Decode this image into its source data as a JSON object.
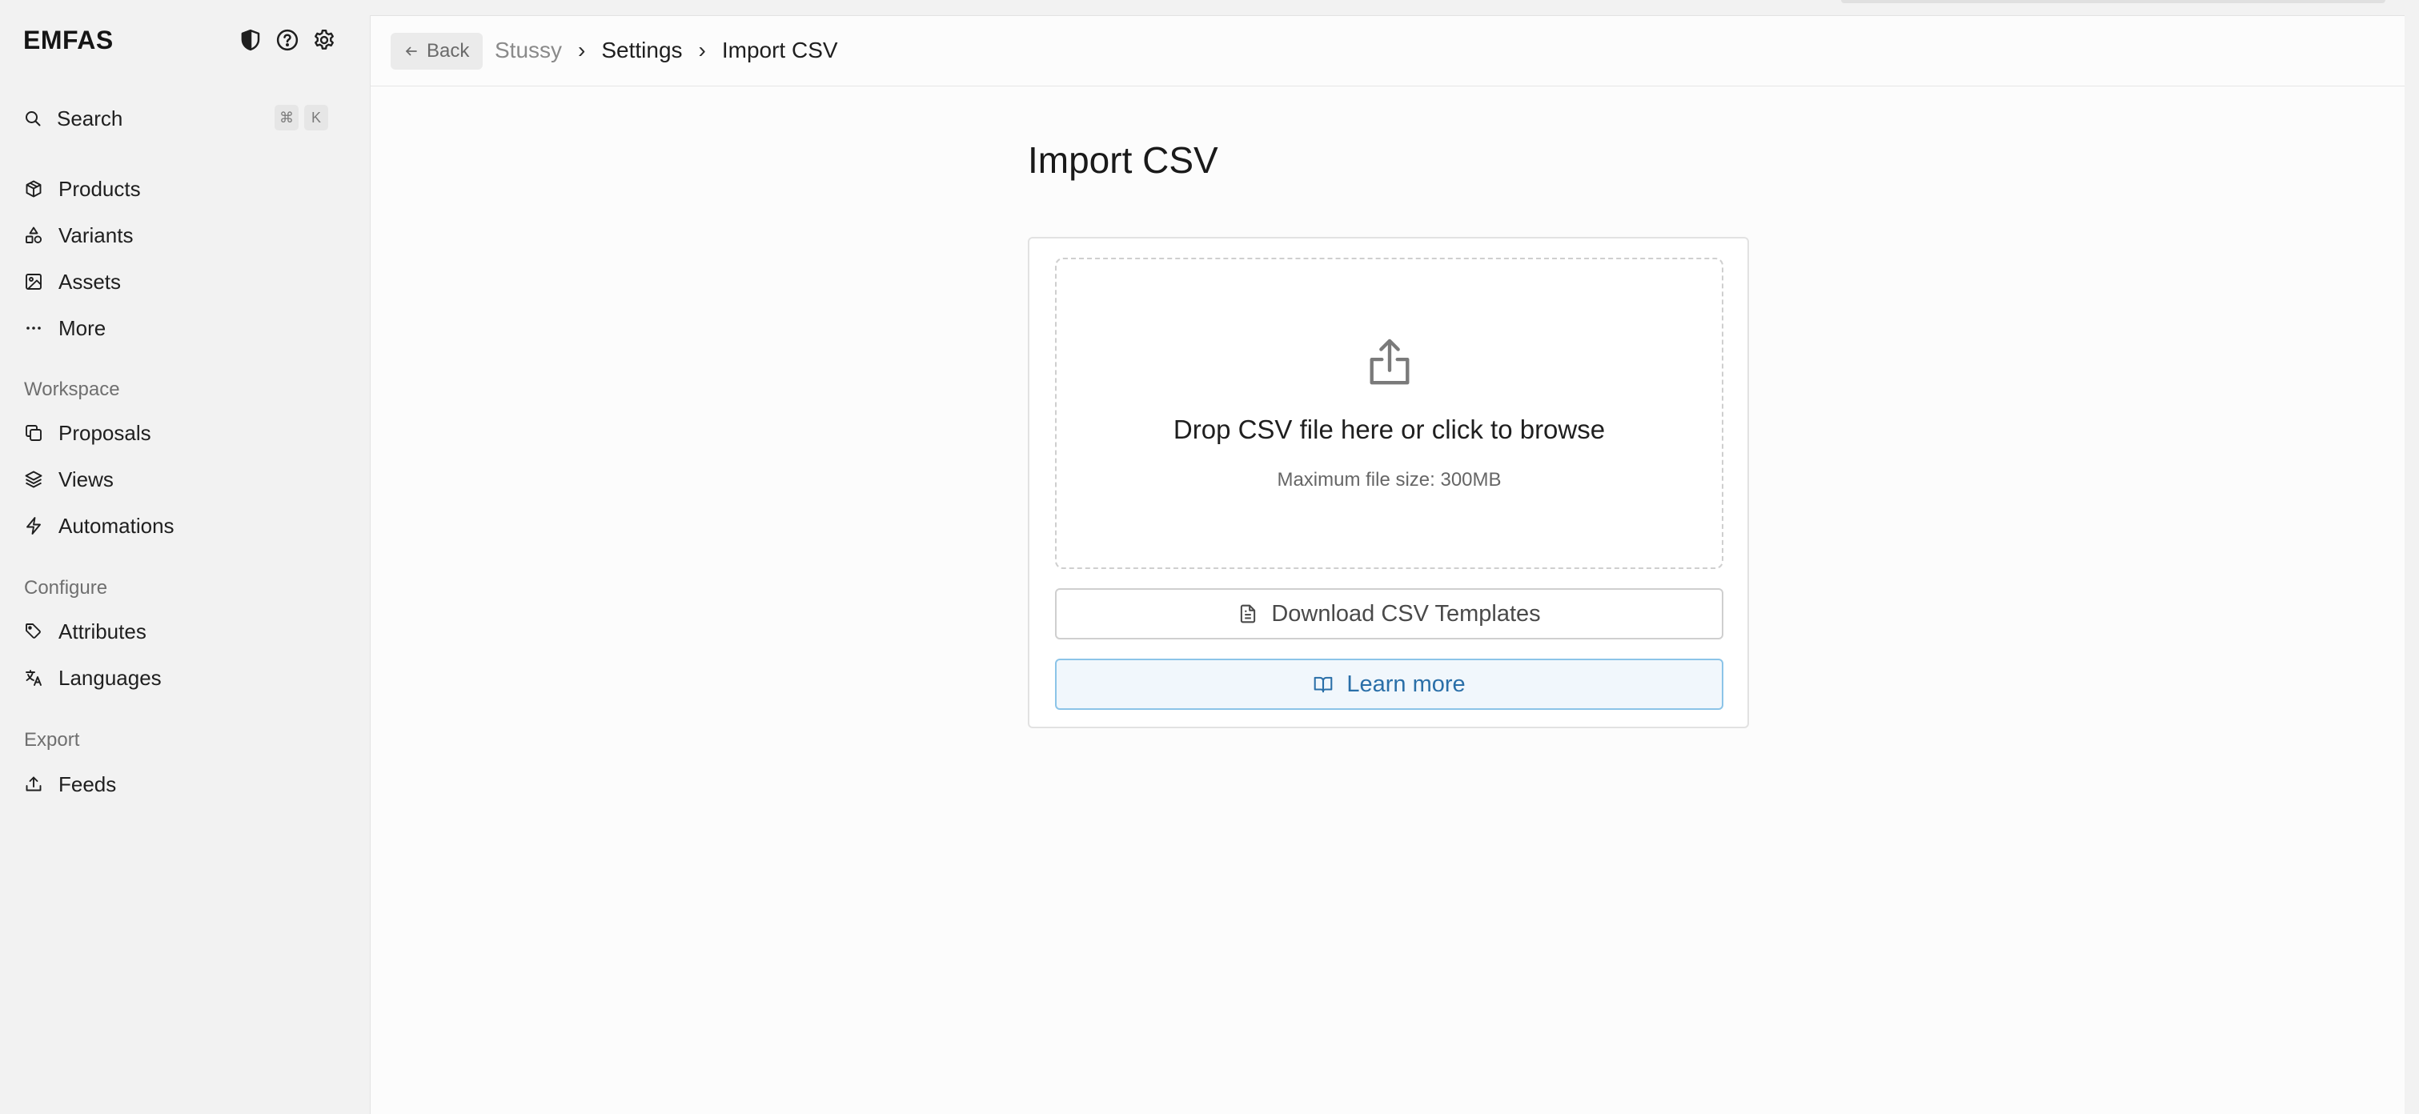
{
  "app": {
    "brand": "EMFAS"
  },
  "sidebar": {
    "search": {
      "label": "Search",
      "shortcut_mod": "⌘",
      "shortcut_key": "K"
    },
    "items": [
      {
        "label": "Products",
        "icon": "box-icon"
      },
      {
        "label": "Variants",
        "icon": "shapes-icon"
      },
      {
        "label": "Assets",
        "icon": "image-icon"
      },
      {
        "label": "More",
        "icon": "ellipsis-icon"
      }
    ],
    "sections": [
      {
        "label": "Workspace",
        "items": [
          {
            "label": "Proposals",
            "icon": "copy-icon"
          },
          {
            "label": "Views",
            "icon": "layers-icon"
          },
          {
            "label": "Automations",
            "icon": "zap-icon"
          }
        ]
      },
      {
        "label": "Configure",
        "items": [
          {
            "label": "Attributes",
            "icon": "tags-icon"
          },
          {
            "label": "Languages",
            "icon": "languages-icon"
          }
        ]
      },
      {
        "label": "Export",
        "items": [
          {
            "label": "Feeds",
            "icon": "upload-icon"
          }
        ]
      }
    ]
  },
  "topbar": {
    "back_label": "Back",
    "breadcrumbs": [
      "Stussy",
      "Settings"
    ],
    "current": "Import CSV"
  },
  "main": {
    "title": "Import CSV",
    "dropzone": {
      "title": "Drop CSV file here or click to browse",
      "subtitle": "Maximum file size: 300MB"
    },
    "download_button": "Download CSV Templates",
    "learn_button": "Learn more"
  },
  "colors": {
    "sidebar_bg": "#f2f2f2",
    "main_bg": "#fcfcfc",
    "learn_border": "#8cc4e8",
    "learn_text": "#2a6fa8"
  }
}
